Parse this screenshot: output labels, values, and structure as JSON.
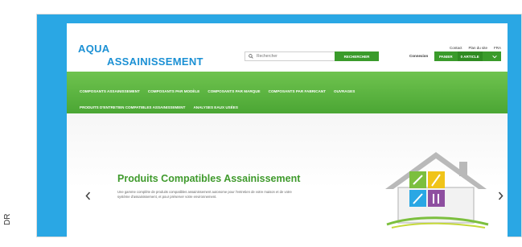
{
  "credit": "DR",
  "logo": {
    "line1": "AQUA",
    "line2": "ASSAINISSEMENT"
  },
  "search": {
    "placeholder": "Rechercher",
    "button_label": "RECHERCHER"
  },
  "top_links": [
    "Contact",
    "Plan du site",
    "FRA"
  ],
  "account": {
    "label": "Connexion",
    "primary": "PANIER",
    "secondary": "0 ARTICLE"
  },
  "nav": {
    "row1": [
      "COMPOSANTS ASSAINISSEMENT",
      "COMPOSANTS PAR MODÈLE",
      "COMPOSANTS PAR MARQUE",
      "COMPOSANTS PAR FABRICANT",
      "OUVRAGES"
    ],
    "row2": [
      "PRODUITS D'ENTRETIEN COMPATIBLES ASSAINISSEMENT",
      "ANALYSES EAUX USÉES"
    ]
  },
  "banner": {
    "title": "Produits Compatibles Assainissement",
    "text": "Une gamme complète de produits compatibles assainissement autonome pour l'entretien de votre maison et de votre système d'assainissement, et pour préserver votre environnement."
  },
  "colors": {
    "brand_blue": "#1b90d4",
    "frame_blue": "#2aa7e4",
    "nav_green": "#4ba634",
    "title_green": "#3f9a2c"
  },
  "icons": [
    "search-icon",
    "chevron-down-icon",
    "chevron-left-icon",
    "chevron-right-icon",
    "house-illustration"
  ]
}
